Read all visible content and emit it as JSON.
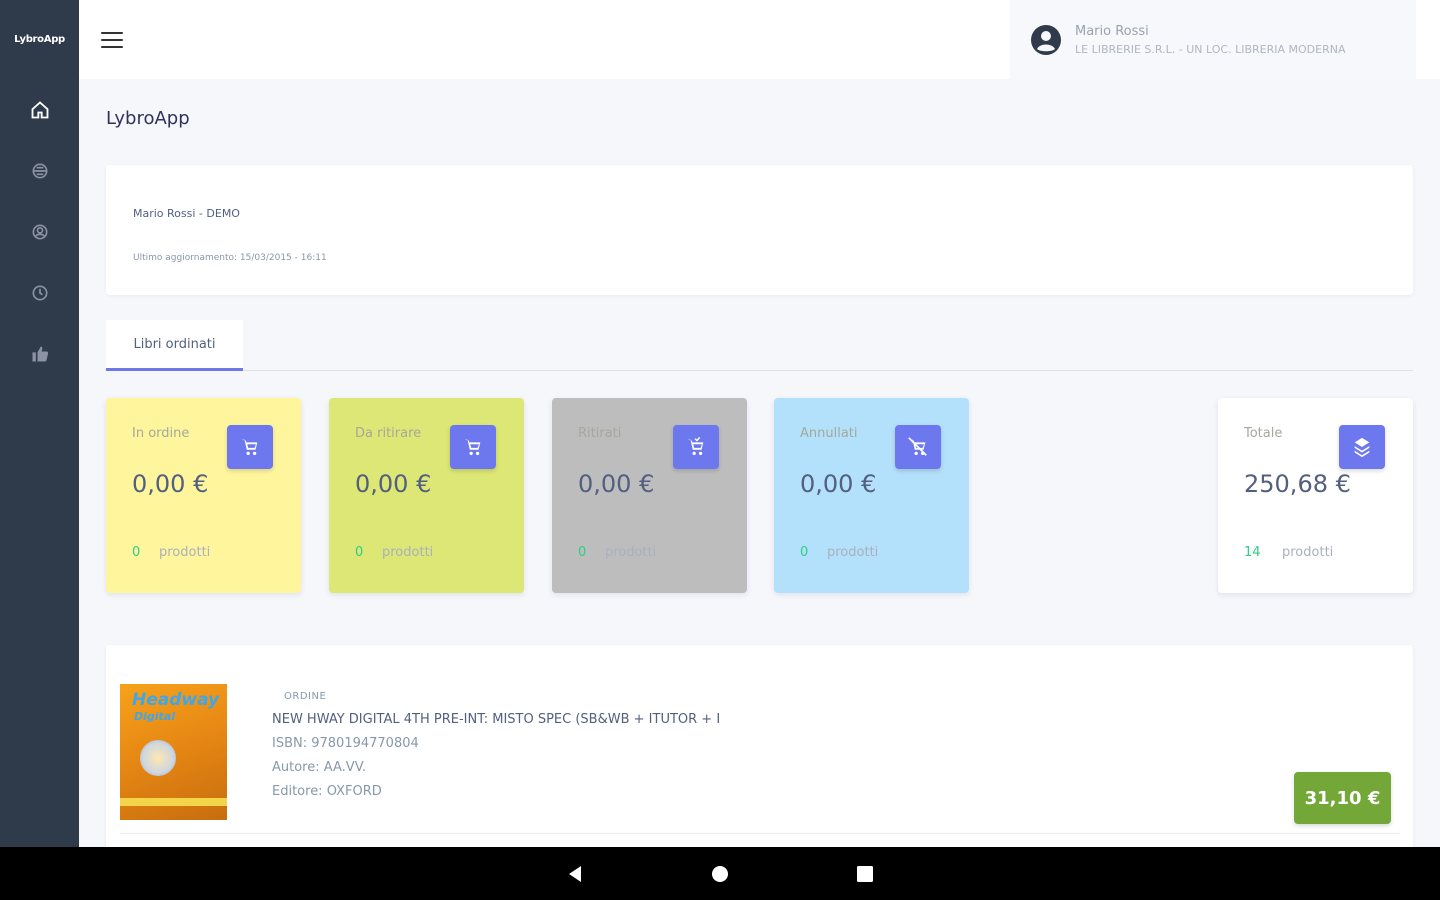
{
  "app": {
    "brand": "LybroApp",
    "page_title": "LybroApp"
  },
  "sidebar": {
    "items": [
      {
        "icon": "home-icon",
        "active": true
      },
      {
        "icon": "box-icon"
      },
      {
        "icon": "user-circle-icon"
      },
      {
        "icon": "clock-icon"
      },
      {
        "icon": "thumbs-up-icon"
      }
    ]
  },
  "user": {
    "name": "Mario Rossi",
    "store": "LE LIBRERIE S.R.L. - UN LOC. LIBRERIA MODERNA"
  },
  "info": {
    "customer": "Mario Rossi - DEMO",
    "last_update": "Ultimo aggiornamento: 15/03/2015 - 16:11"
  },
  "tabs": [
    {
      "label": "Libri ordinati",
      "active": true
    }
  ],
  "stats": [
    {
      "label": "In ordine",
      "amount": "0,00 €",
      "count": "0",
      "unit": "prodotti",
      "bg": "#fff59d",
      "icon": "cart-icon"
    },
    {
      "label": "Da ritirare",
      "amount": "0,00 €",
      "count": "0",
      "unit": "prodotti",
      "bg": "#dce775",
      "icon": "cart-icon"
    },
    {
      "label": "Ritirati",
      "amount": "0,00 €",
      "count": "0",
      "unit": "prodotti",
      "bg": "#bdbdbd",
      "icon": "cart-check-icon"
    },
    {
      "label": "Annullati",
      "amount": "0,00 €",
      "count": "0",
      "unit": "prodotti",
      "bg": "#b3e0fb",
      "icon": "cart-cancel-icon"
    }
  ],
  "total": {
    "label": "Totale",
    "amount": "250,68 €",
    "count": "14",
    "unit": "prodotti",
    "bg": "#ffffff",
    "icon": "layers-icon"
  },
  "orders": [
    {
      "type": "ORDINE",
      "title": "NEW HWAY DIGITAL 4TH PRE-INT: MISTO SPEC (SB&WB + ITUTOR + I",
      "isbn": "ISBN: 9780194770804",
      "author": "Autore: AA.VV.",
      "publisher": "Editore: OXFORD",
      "price": "31,10 €",
      "cover_title": "Headway",
      "cover_subtitle": "Digital"
    }
  ],
  "colors": {
    "sidebar": "#2f3a4a",
    "accent": "#6e78ee",
    "price_bg": "#73a839",
    "count": "#2dce89"
  }
}
